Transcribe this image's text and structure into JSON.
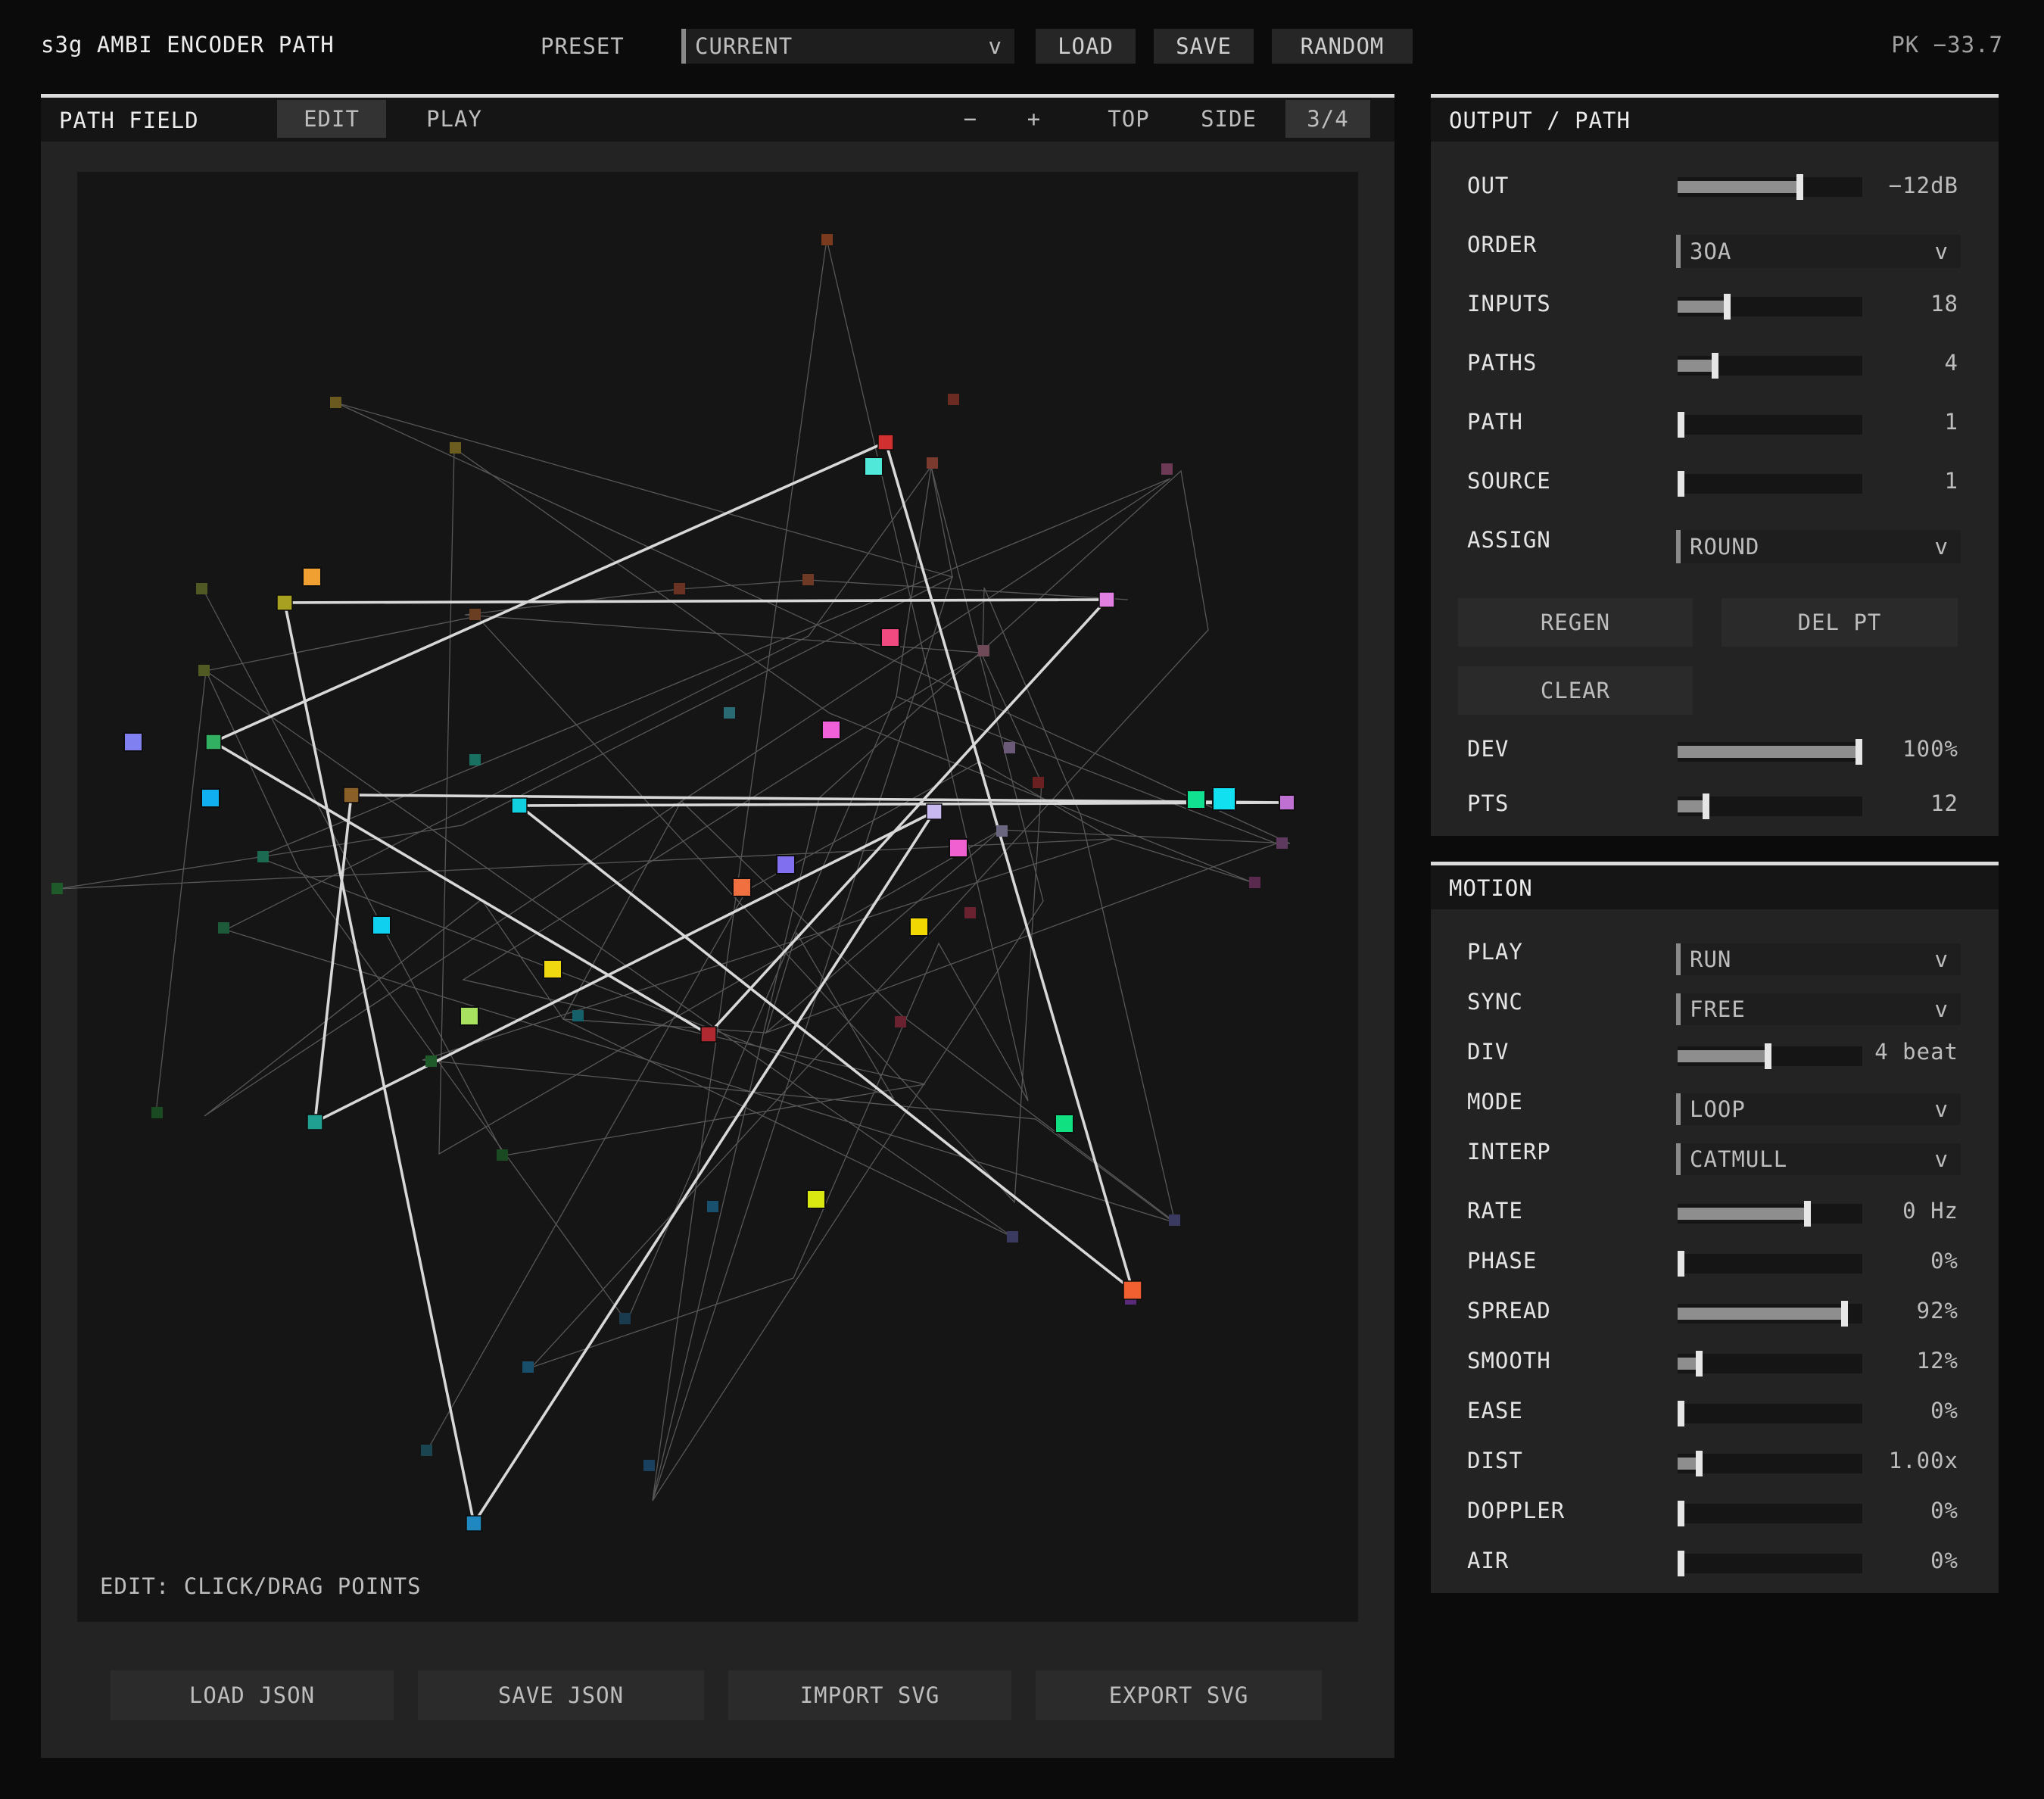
{
  "app": {
    "title": "s3g AMBI ENCODER PATH",
    "peak": "PK −33.7"
  },
  "preset": {
    "label": "PRESET",
    "selected": "CURRENT",
    "chevron": "v",
    "load": "LOAD",
    "save": "SAVE",
    "random": "RANDOM"
  },
  "field_panel": {
    "title": "PATH FIELD",
    "tabs": {
      "edit": "EDIT",
      "play": "PLAY"
    },
    "zoom_out": "−",
    "zoom_in": "+",
    "views": {
      "top": "TOP",
      "side": "SIDE",
      "three_quarter": "3/4"
    },
    "hint": "EDIT: CLICK/DRAG POINTS",
    "buttons": {
      "load_json": "LOAD JSON",
      "save_json": "SAVE JSON",
      "import_svg": "IMPORT SVG",
      "export_svg": "EXPORT SVG"
    }
  },
  "output_panel": {
    "title": "OUTPUT / PATH",
    "out": {
      "label": "OUT",
      "value": "−12dB",
      "level": 0.67
    },
    "order": {
      "label": "ORDER",
      "selected": "3OA"
    },
    "inputs": {
      "label": "INPUTS",
      "value": "18",
      "level": 0.26
    },
    "paths": {
      "label": "PATHS",
      "value": "4",
      "level": 0.19
    },
    "path": {
      "label": "PATH",
      "value": "1",
      "level": 0.0
    },
    "source": {
      "label": "SOURCE",
      "value": "1",
      "level": 0.0
    },
    "assign": {
      "label": "ASSIGN",
      "selected": "ROUND"
    },
    "regen": "REGEN",
    "del_pt": "DEL PT",
    "clear": "CLEAR",
    "dev": {
      "label": "DEV",
      "value": "100%",
      "level": 1.0
    },
    "pts": {
      "label": "PTS",
      "value": "12",
      "level": 0.14
    }
  },
  "motion_panel": {
    "title": "MOTION",
    "play": {
      "label": "PLAY",
      "selected": "RUN"
    },
    "sync": {
      "label": "SYNC",
      "selected": "FREE"
    },
    "div": {
      "label": "DIV",
      "value": "4 beat",
      "level": 0.49
    },
    "mode": {
      "label": "MODE",
      "selected": "LOOP"
    },
    "interp": {
      "label": "INTERP",
      "selected": "CATMULL"
    },
    "rate": {
      "label": "RATE",
      "value": "0 Hz",
      "level": 0.71
    },
    "phase": {
      "label": "PHASE",
      "value": "0%",
      "level": 0.0
    },
    "spread": {
      "label": "SPREAD",
      "value": "92%",
      "level": 0.92
    },
    "smooth": {
      "label": "SMOOTH",
      "value": "12%",
      "level": 0.1
    },
    "ease": {
      "label": "EASE",
      "value": "0%",
      "level": 0.0
    },
    "dist": {
      "label": "DIST",
      "value": "1.00x",
      "level": 0.1
    },
    "doppler": {
      "label": "DOPPLER",
      "value": "0%",
      "level": 0.0
    },
    "air": {
      "label": "AIR",
      "value": "0%",
      "level": 0.0
    }
  },
  "colors": {
    "accent": "#dcdcdc",
    "panel": "#232323",
    "field_bg": "#151515"
  }
}
